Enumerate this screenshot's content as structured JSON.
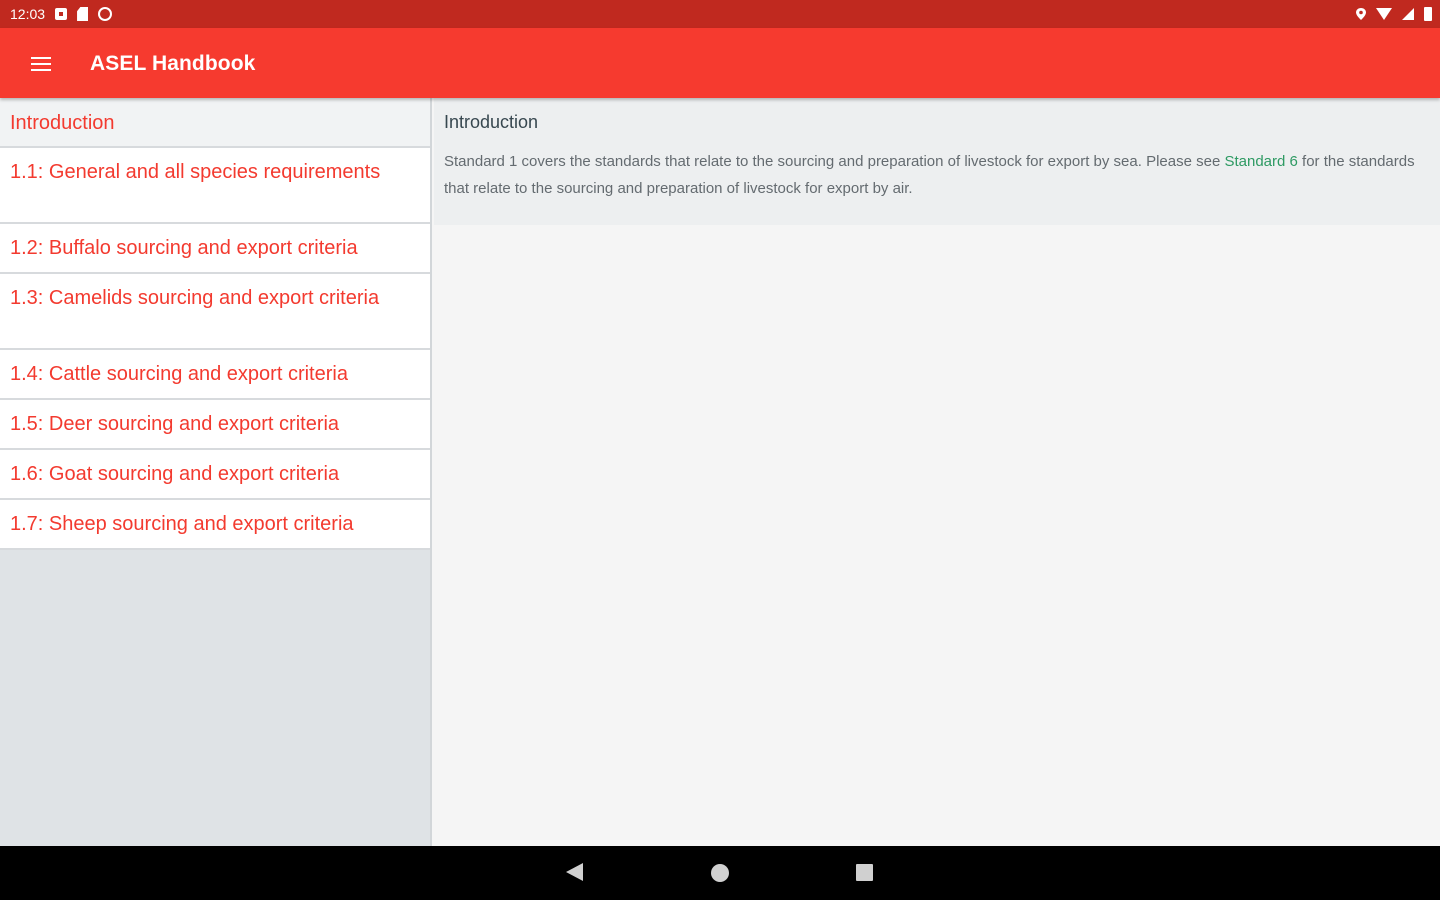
{
  "status_bar": {
    "time": "12:03",
    "left_icons": [
      "notification-icon",
      "sd-card-icon",
      "sync-icon"
    ],
    "right_icons": [
      "location-icon",
      "wifi-icon",
      "signal-icon",
      "battery-icon"
    ]
  },
  "app_bar": {
    "title": "ASEL Handbook",
    "menu_icon": "hamburger-menu-icon",
    "background": "#f63a2f"
  },
  "sidebar": {
    "items": [
      {
        "label": "Introduction"
      },
      {
        "label": "1.1: General and all species requirements"
      },
      {
        "label": "1.2: Buffalo sourcing and export criteria"
      },
      {
        "label": "1.3: Camelids sourcing and export criteria"
      },
      {
        "label": "1.4: Cattle sourcing and export criteria"
      },
      {
        "label": "1.5: Deer sourcing and export criteria"
      },
      {
        "label": "1.6: Goat sourcing and export criteria"
      },
      {
        "label": "1.7: Sheep sourcing and export criteria"
      }
    ],
    "accent": "#f33a2f"
  },
  "content": {
    "title": "Introduction",
    "body_before_link": "Standard 1 covers the standards that relate to the sourcing and preparation of livestock for export by sea. Please see ",
    "link_text": "Standard 6",
    "body_after_link": " for the standards that relate to the sourcing and preparation of livestock for export by air.",
    "link_color": "#2e9a63"
  },
  "nav_bar": {
    "icons": [
      "back-icon",
      "home-icon",
      "recents-icon"
    ]
  }
}
